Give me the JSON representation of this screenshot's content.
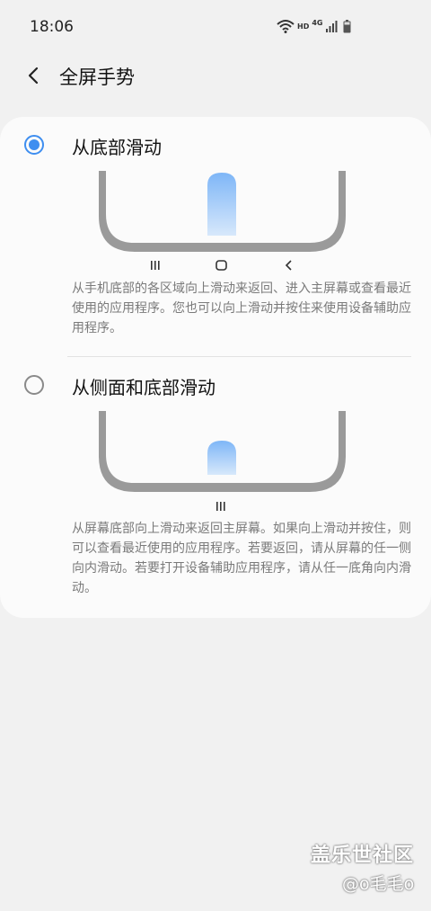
{
  "status": {
    "time": "18:06",
    "hd": "HD",
    "network": "4G"
  },
  "header": {
    "title": "全屏手势"
  },
  "options": [
    {
      "label": "从底部滑动",
      "selected": true,
      "description": "从手机底部的各区域向上滑动来返回、进入主屏幕或查看最近使用的应用程序。您也可以向上滑动并按住来使用设备辅助应用程序。"
    },
    {
      "label": "从侧面和底部滑动",
      "selected": false,
      "description": "从屏幕底部向上滑动来返回主屏幕。如果向上滑动并按住，则可以查看最近使用的应用程序。若要返回，请从屏幕的任一侧向内滑动。若要打开设备辅助应用程序，请从任一底角向内滑动。"
    }
  ],
  "watermark": {
    "site": "盖乐世社区",
    "user": "@o毛毛o"
  },
  "colors": {
    "accent": "#3e8ef0",
    "background": "#f1f1f1",
    "card": "#fbfbfb"
  }
}
